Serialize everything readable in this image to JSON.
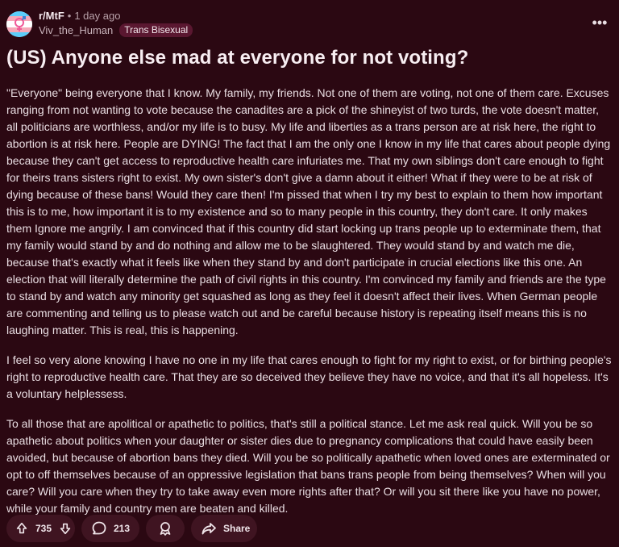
{
  "post": {
    "subreddit": "r/MtF",
    "time": "1 day ago",
    "username": "Viv_the_Human",
    "flair": "Trans Bisexual",
    "title": "(US) Anyone else mad at everyone for not voting?",
    "paragraphs": [
      "\"Everyone\" being everyone that I know. My family, my friends. Not one of them are voting, not one of them care. Excuses ranging from not wanting to vote because the canadites are a pick of the shineyist of two turds, the vote doesn't matter, all politicians are worthless, and/or my life is to busy. My life and liberties as a trans person are at risk here, the right to abortion is at risk here. People are DYING! The fact that I am the only one I know in my life that cares about people dying because they can't get access to reproductive health care infuriates me. That my own siblings don't care enough to fight for theirs trans sisters right to exist. My own sister's don't give a damn about it either! What if they were to be at risk of dying because of these bans! Would they care then! I'm pissed that when I try my best to explain to them how important this is to me, how important it is to my existence and so to many people in this country, they don't care. It only makes them Ignore me angrily. I am convinced that if this country did start locking up trans people up to exterminate them, that my family would stand by and do nothing and allow me to be slaughtered. They would stand by and watch me die, because that's exactly what it feels like when they stand by and don't participate in crucial elections like this one. An election that will literally determine the path of civil rights in this country. I'm convinced my family and friends are the type to stand by and watch any minority get squashed as long as they feel it doesn't affect their lives. When German people are commenting and telling us to please watch out and be careful because history is repeating itself means this is no laughing matter. This is real, this is happening.",
      "I feel so very alone knowing I have no one in my life that cares enough to fight for my right to exist, or for birthing people's right to reproductive health care. That they are so deceived they believe they have no voice, and that it's all hopeless. It's a voluntary helplessess.",
      "To all those that are apolitical or apathetic to politics, that's still a political stance. Let me ask real quick. Will you be so apathetic about politics when your daughter or sister dies due to pregnancy complications that could have easily been avoided, but because of abortion bans they died. Will you be so politically apathetic when loved ones are exterminated or opt to off themselves because of an oppressive legislation that bans trans people from being themselves? When will you care? Will you care when they try to take away even more rights after that? Or will you sit there like you have no power, while your family and country men are beaten and killed."
    ]
  },
  "actions": {
    "votes": "735",
    "comments": "213",
    "share_label": "Share"
  },
  "separator": "•",
  "more_label": "•••",
  "colors": {
    "background": "#2b0812",
    "pill": "#3f1421",
    "flair": "#5a1730",
    "avatar_blue": "#5bcefa",
    "avatar_pink": "#f5a9b8"
  },
  "icons": {
    "avatar": "trans-flag-avatar",
    "upvote": "arrow-up-icon",
    "downvote": "arrow-down-icon",
    "comment": "comment-bubble-icon",
    "award": "award-icon",
    "share": "share-arrow-icon",
    "more": "more-options-icon"
  }
}
